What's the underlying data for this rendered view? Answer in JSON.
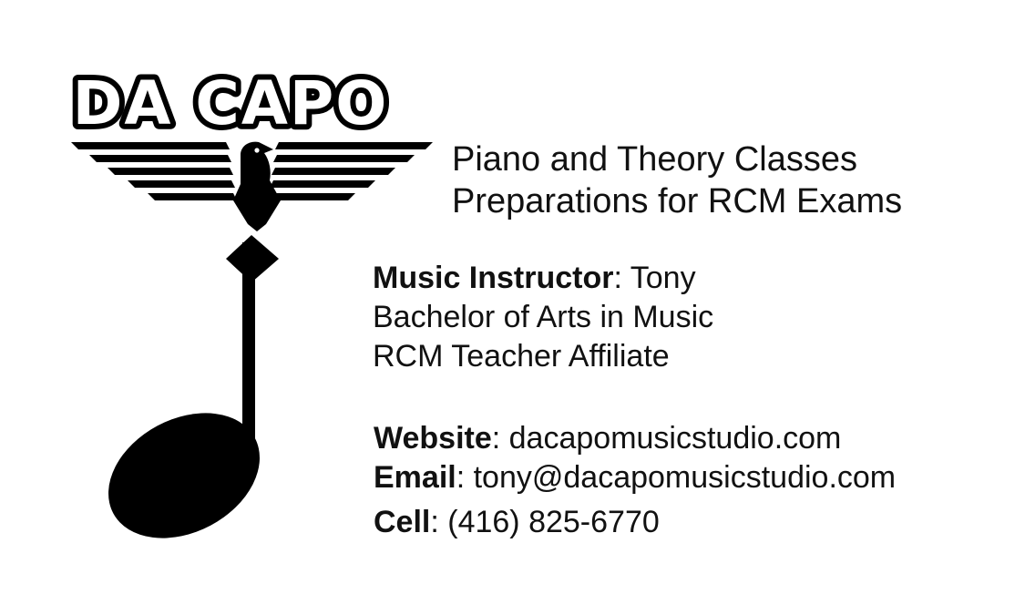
{
  "logo": {
    "text": "DA CAPO",
    "icon": "eagle-music-note-icon",
    "color": "#000000"
  },
  "tagline": {
    "line1": "Piano and Theory Classes",
    "line2": "Preparations for RCM Exams"
  },
  "instructor": {
    "label": "Music Instructor",
    "name": ": Tony",
    "degree": "Bachelor of Arts in Music",
    "affiliation": "RCM Teacher Affiliate"
  },
  "contact": {
    "website_label": "Website",
    "website_value": ": dacapomusicstudio.com",
    "email_label": "Email",
    "email_value": ": tony@dacapomusicstudio.com",
    "cell_label": "Cell",
    "cell_value": ": (416) 825-6770"
  }
}
